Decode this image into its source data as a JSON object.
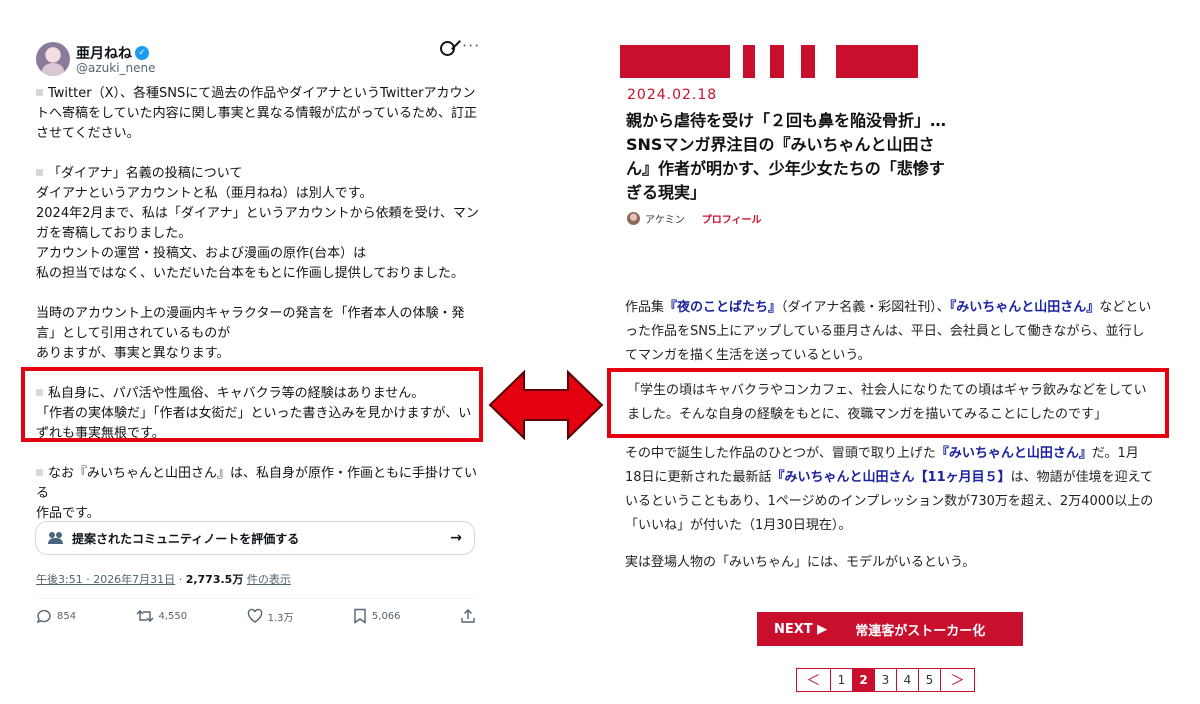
{
  "tweet": {
    "display_name": "亜月ねね",
    "handle": "@azuki_nene",
    "paragraphs": [
      "Twitter（X）、各種SNSにて過去の作品やダイアナというTwitterアカウントへ寄稿をしていた内容に関し事実と異なる情報が広がっているため、訂正させてください。",
      "「ダイアナ」名義の投稿について\nダイアナというアカウントと私（亜月ねね）は別人です。\n2024年2月まで、私は「ダイアナ」というアカウントから依頼を受け、マンガを寄稿しておりました。\nアカウントの運営・投稿文、および漫画の原作(台本）は\n私の担当ではなく、いただいた台本をもとに作画し提供しておりました。",
      "当時のアカウント上の漫画内キャラクターの発言を「作者本人の体験・発言」として引用されているものが\nありますが、事実と異なります。",
      "私自身に、パパ活や性風俗、キャバクラ等の経験はありません。\n「作者の実体験だ」「作者は女衒だ」といった書き込みを見かけますが、いずれも事実無根です。",
      "なお『みいちゃんと山田さん』は、私自身が原作・作画ともに手掛けている\n作品です。"
    ],
    "community_note_label": "提案されたコミュニティノートを評価する",
    "timestamp": "午後3:51 · 2026年7月31日",
    "views_count": "2,773.5万",
    "views_label": "件の表示",
    "actions": {
      "replies": "854",
      "retweets": "4,550",
      "likes": "1.3万",
      "bookmarks": "5,066"
    },
    "icons": [
      "verified-badge-icon",
      "grok-icon",
      "more-icon",
      "community-notes-icon",
      "reply-icon",
      "retweet-icon",
      "like-icon",
      "bookmark-icon",
      "share-icon"
    ]
  },
  "article": {
    "date": "2024.02.18",
    "headline": "親から虐待を受け「２回も鼻を陥没骨折」…SNSマンガ界注目の『みいちゃんと山田さん』作者が明かす、少年少女たちの「悲惨すぎる現実」",
    "author": "アケミン",
    "profile_label": "プロフィール",
    "para1": {
      "t1": "作品集",
      "l1": "『夜のことばたち』",
      "t2": "（ダイアナ名義・彩図社刊）、",
      "l2": "『みいちゃんと山田さん』",
      "t3": "などといった作品をSNS上にアップしている亜月さんは、平日、会社員として働きながら、並行してマンガを描く生活を送っているという。"
    },
    "quote": "「学生の頃はキャバクラやコンカフェ、社会人になりたての頃はギャラ飲みなどをしていました。そんな自身の経験をもとに、夜職マンガを描いてみることにしたのです」",
    "para2": {
      "t1": "その中で誕生した作品のひとつが、冒頭で取り上げた",
      "l1": "『みいちゃんと山田さん』",
      "t2": "だ。1月18日に更新された最新話",
      "l2": "『みいちゃんと山田さん【11ヶ月目５】",
      "t3": "は、物語が佳境を迎えているということもあり、1ページめのインプレッション数が730万を超え、2万4000以上の「いいね」が付いた（1月30日現在）。"
    },
    "para3": "実は登場人物の「みいちゃん」には、モデルがいるという。",
    "next_label": "NEXT ▶",
    "next_title": "常連客がストーカー化",
    "pagination": {
      "prev": "＜",
      "pages": [
        "1",
        "2",
        "3",
        "4",
        "5"
      ],
      "current": "2",
      "next": "＞"
    },
    "brand_color": "#c8102e"
  },
  "annotation": {
    "highlight_color": "#e3000f"
  }
}
